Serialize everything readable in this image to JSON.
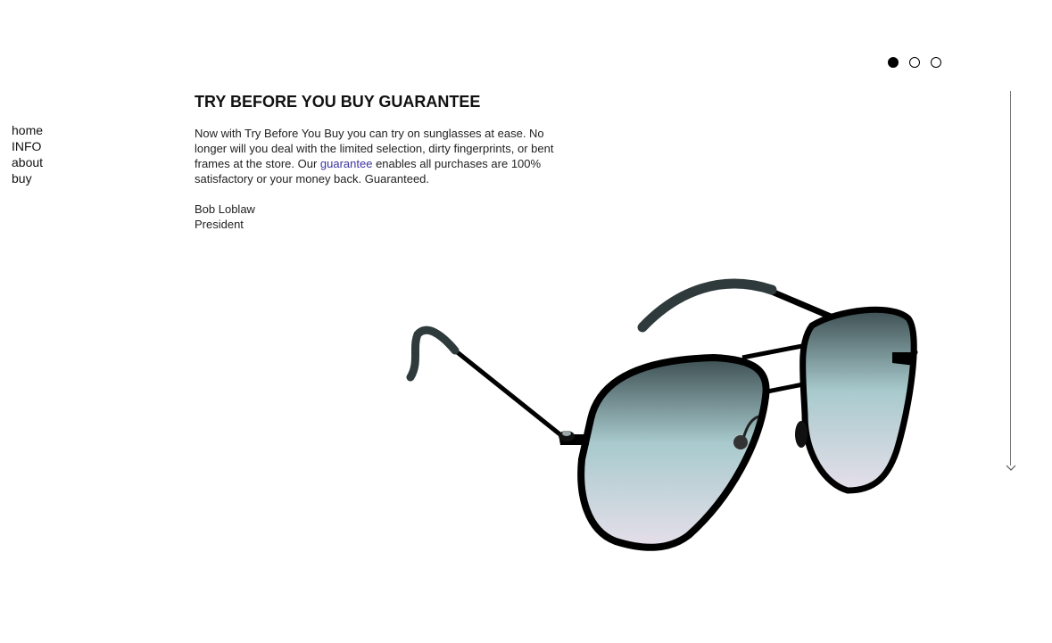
{
  "nav": {
    "items": [
      {
        "label": "home"
      },
      {
        "label": "INFO"
      },
      {
        "label": "about"
      },
      {
        "label": "buy"
      }
    ]
  },
  "slider": {
    "count": 3,
    "active_index": 0
  },
  "content": {
    "headline": "TRY BEFORE YOU BUY GUARANTEE",
    "paragraph_before_link": "Now with Try Before You Buy you can try on sunglasses at ease. No longer will you deal with the limited selection, dirty fingerprints, or bent frames at the store. Our ",
    "link_text": "guarantee",
    "paragraph_after_link": " enables all purchases are 100% satisfactory or your money back. Guaranteed.",
    "signature_name": "Bob Loblaw",
    "signature_title": "President"
  },
  "colors": {
    "link": "#3a33a3",
    "frame": "#000000",
    "lens_top": "#3d4f52",
    "lens_mid": "#a8cacd",
    "lens_bottom": "#e6dfea"
  },
  "icons": {
    "scroll": "arrow-down-icon",
    "product": "aviator-sunglasses"
  }
}
